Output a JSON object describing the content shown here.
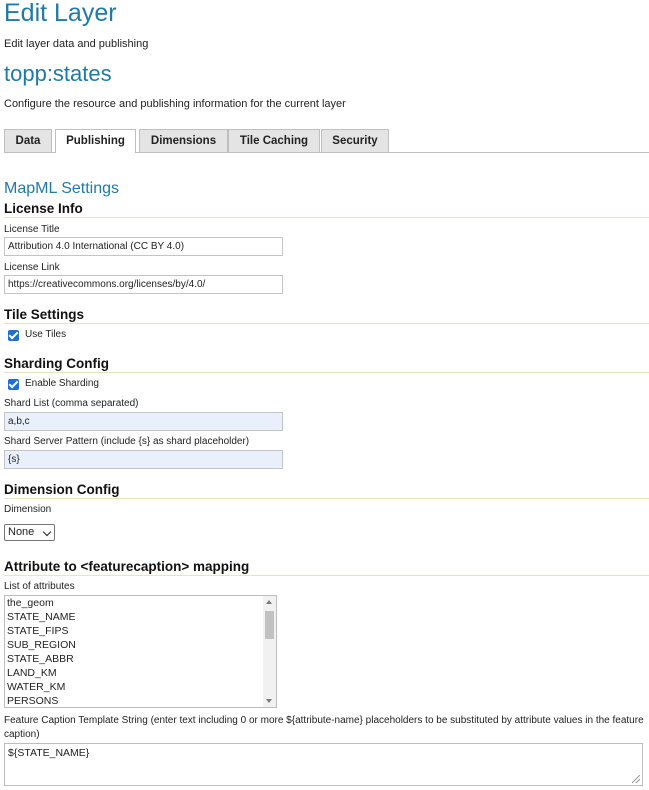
{
  "page": {
    "title": "Edit Layer",
    "subtitle": "Edit layer data and publishing",
    "layer_name": "topp:states",
    "layer_description": "Configure the resource and publishing information for the current layer"
  },
  "tabs": [
    {
      "label": "Data",
      "active": false
    },
    {
      "label": "Publishing",
      "active": true
    },
    {
      "label": "Dimensions",
      "active": false
    },
    {
      "label": "Tile Caching",
      "active": false
    },
    {
      "label": "Security",
      "active": false
    }
  ],
  "mapml": {
    "heading": "MapML Settings",
    "license": {
      "heading": "License Info",
      "title_label": "License Title",
      "title_value": "Attribution 4.0 International (CC BY 4.0)",
      "link_label": "License Link",
      "link_value": "https://creativecommons.org/licenses/by/4.0/"
    },
    "tiles": {
      "heading": "Tile Settings",
      "use_tiles_label": "Use Tiles",
      "use_tiles_checked": true
    },
    "sharding": {
      "heading": "Sharding Config",
      "enable_label": "Enable Sharding",
      "enable_checked": true,
      "shard_list_label": "Shard List (comma separated)",
      "shard_list_value": "a,b,c",
      "pattern_label": "Shard Server Pattern (include {s} as shard placeholder)",
      "pattern_value": "{s}"
    },
    "dimension": {
      "heading": "Dimension Config",
      "label": "Dimension",
      "selected": "None"
    },
    "caption": {
      "heading": "Attribute to <featurecaption> mapping",
      "list_label": "List of attributes",
      "attributes": [
        "the_geom",
        "STATE_NAME",
        "STATE_FIPS",
        "SUB_REGION",
        "STATE_ABBR",
        "LAND_KM",
        "WATER_KM",
        "PERSONS"
      ],
      "template_label": "Feature Caption Template String (enter text including 0 or more ${attribute-name} placeholders to be substituted by attribute values in the feature caption)",
      "template_value": "${STATE_NAME}"
    }
  },
  "colors": {
    "heading_blue": "#1f7aa8",
    "checkbox_blue": "#1e6fd1",
    "autofill_bg": "#e9f0fb"
  }
}
